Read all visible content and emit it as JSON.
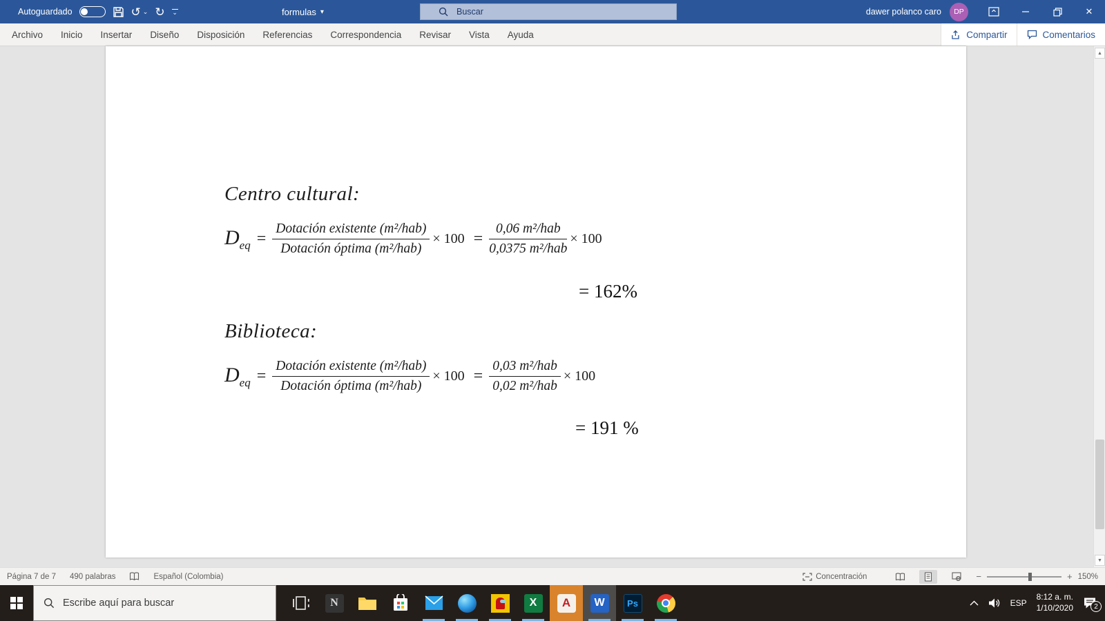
{
  "titlebar": {
    "autosave_label": "Autoguardado",
    "doc_title": "formulas",
    "search_placeholder": "Buscar",
    "user_name": "dawer polanco caro",
    "avatar_initials": "DP"
  },
  "ribbon": {
    "tabs": [
      "Archivo",
      "Inicio",
      "Insertar",
      "Diseño",
      "Disposición",
      "Referencias",
      "Correspondencia",
      "Revisar",
      "Vista",
      "Ayuda"
    ],
    "share_label": "Compartir",
    "comments_label": "Comentarios"
  },
  "document": {
    "heading1": "Centro cultural:",
    "heading2": "Biblioteca:",
    "eq1": {
      "lhs": "D",
      "sub": "eq",
      "equals": "=",
      "num1": "Dotación existente (m²/hab)",
      "den1": "Dotación óptima (m²/hab)",
      "times1": "× 100",
      "equals2": "=",
      "num2": "0,06 m²/hab",
      "den2": "0,0375 m²/hab",
      "times2": "× 100",
      "result": "= 162%"
    },
    "eq2": {
      "lhs": "D",
      "sub": "eq",
      "equals": "=",
      "num1": "Dotación existente (m²/hab)",
      "den1": "Dotación óptima (m²/hab)",
      "times1": "× 100",
      "equals2": "=",
      "num2": "0,03 m²/hab",
      "den2": "0,02 m²/hab",
      "times2": "× 100",
      "result": "= 191 %"
    }
  },
  "statusbar": {
    "page_info": "Página 7 de 7",
    "word_count": "490 palabras",
    "language": "Español (Colombia)",
    "focus_label": "Concentración",
    "zoom_level": "150%"
  },
  "taskbar": {
    "search_placeholder": "Escribe aquí para buscar",
    "language_code": "ESP",
    "time": "8:12 a. m.",
    "date": "1/10/2020",
    "notification_count": "2",
    "app_glyphs": {
      "notion": "N",
      "excel": "X",
      "autocad": "A",
      "word": "W",
      "photoshop": "Ps"
    }
  },
  "icons": {
    "undo": "↺",
    "redo": "↻",
    "dropdown_caret": "▾",
    "small_chevron": "⌄",
    "close": "✕",
    "scroll_up": "▲",
    "scroll_down": "▼",
    "zoom_out": "−",
    "zoom_in": "+"
  }
}
